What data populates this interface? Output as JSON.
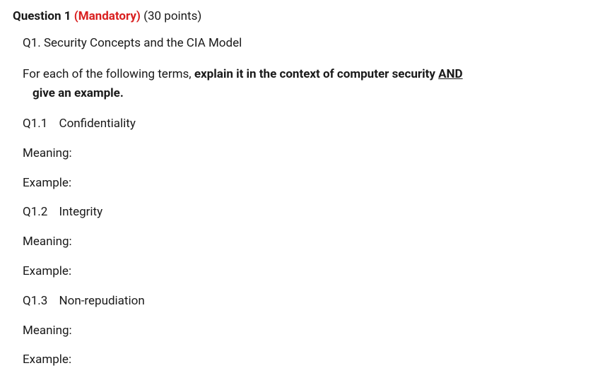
{
  "heading": {
    "question_label": "Question 1",
    "mandatory_label": "(Mandatory)",
    "points_label": "(30 points)"
  },
  "subtitle": "Q1. Security Concepts and the CIA Model",
  "instructions": {
    "part1": "For each of the following terms, ",
    "bold_part1": "explain it in the context of computer security ",
    "and_word": "AND",
    "bold_part2": "give an example."
  },
  "items": [
    {
      "num": "Q1.1",
      "term": "Confidentiality"
    },
    {
      "num": "Q1.2",
      "term": "Integrity"
    },
    {
      "num": "Q1.3",
      "term": "Non-repudiation"
    }
  ],
  "fields": {
    "meaning": "Meaning:",
    "example": "Example:"
  }
}
